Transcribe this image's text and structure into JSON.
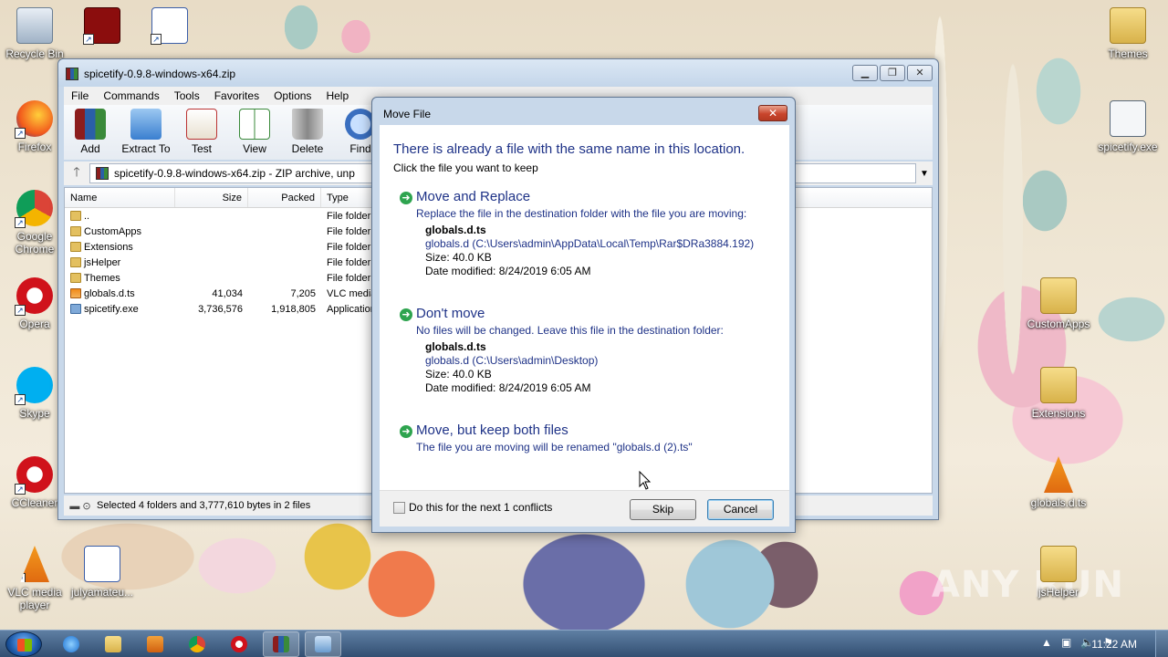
{
  "desktop": {
    "icons": [
      {
        "id": "recycle-bin",
        "label": "Recycle Bin"
      },
      {
        "id": "acrobat",
        "label": ""
      },
      {
        "id": "word-doc-top",
        "label": ""
      },
      {
        "id": "firefox",
        "label": "Firefox"
      },
      {
        "id": "chrome",
        "label": "Google Chrome"
      },
      {
        "id": "opera",
        "label": "Opera"
      },
      {
        "id": "skype",
        "label": "Skype"
      },
      {
        "id": "ccleaner",
        "label": "CCleaner"
      },
      {
        "id": "vlc",
        "label": "VLC media player"
      },
      {
        "id": "julyamateur",
        "label": "julyamateu..."
      },
      {
        "id": "themes",
        "label": "Themes"
      },
      {
        "id": "spicetify-exe",
        "label": "spicetify.exe"
      },
      {
        "id": "customapps",
        "label": "CustomApps"
      },
      {
        "id": "extensions",
        "label": "Extensions"
      },
      {
        "id": "globals",
        "label": "globals.d.ts"
      },
      {
        "id": "jshelper",
        "label": "jsHelper"
      }
    ],
    "watermark": "ANY RUN"
  },
  "winrar": {
    "title": "spicetify-0.9.8-windows-x64.zip",
    "menu": [
      "File",
      "Commands",
      "Tools",
      "Favorites",
      "Options",
      "Help"
    ],
    "toolbar": [
      {
        "label": "Add",
        "color": "#c33"
      },
      {
        "label": "Extract To",
        "color": "#3a7fd0"
      },
      {
        "label": "Test",
        "color": "#c44"
      },
      {
        "label": "View",
        "color": "#3a8a3a"
      },
      {
        "label": "Delete",
        "color": "#888"
      },
      {
        "label": "Find",
        "color": "#3a6fc0"
      }
    ],
    "address": "spicetify-0.9.8-windows-x64.zip - ZIP archive, unp",
    "columns": {
      "name": "Name",
      "size": "Size",
      "packed": "Packed",
      "type": "Type"
    },
    "rows": [
      {
        "name": "..",
        "size": "",
        "packed": "",
        "type": "File folder",
        "kind": "folder"
      },
      {
        "name": "CustomApps",
        "size": "",
        "packed": "",
        "type": "File folder",
        "kind": "folder"
      },
      {
        "name": "Extensions",
        "size": "",
        "packed": "",
        "type": "File folder",
        "kind": "folder"
      },
      {
        "name": "jsHelper",
        "size": "",
        "packed": "",
        "type": "File folder",
        "kind": "folder"
      },
      {
        "name": "Themes",
        "size": "",
        "packed": "",
        "type": "File folder",
        "kind": "folder"
      },
      {
        "name": "globals.d.ts",
        "size": "41,034",
        "packed": "7,205",
        "type": "VLC media",
        "kind": "vlc"
      },
      {
        "name": "spicetify.exe",
        "size": "3,736,576",
        "packed": "1,918,805",
        "type": "Application",
        "kind": "exe"
      }
    ],
    "status": "Selected 4 folders and 3,777,610 bytes in 2 files"
  },
  "dialog": {
    "title": "Move File",
    "heading": "There is already a file with the same name in this location.",
    "subheading": "Click the file you want to keep",
    "options": [
      {
        "title": "Move and Replace",
        "desc": "Replace the file in the destination folder with the file you are moving:",
        "file_name": "globals.d.ts",
        "file_path": "globals.d (C:\\Users\\admin\\AppData\\Local\\Temp\\Rar$DRa3884.192)",
        "size": "Size: 40.0 KB",
        "modified": "Date modified: 8/24/2019 6:05 AM"
      },
      {
        "title": "Don't move",
        "desc": "No files will be changed. Leave this file in the destination folder:",
        "file_name": "globals.d.ts",
        "file_path": "globals.d (C:\\Users\\admin\\Desktop)",
        "size": "Size: 40.0 KB",
        "modified": "Date modified: 8/24/2019 6:05 AM"
      },
      {
        "title": "Move, but keep both files",
        "desc": "The file you are moving will be renamed \"globals.d (2).ts\""
      }
    ],
    "checkbox_label": "Do this for the next 1 conflicts",
    "skip_label": "Skip",
    "cancel_label": "Cancel"
  },
  "taskbar": {
    "clock": "11:22 AM"
  }
}
